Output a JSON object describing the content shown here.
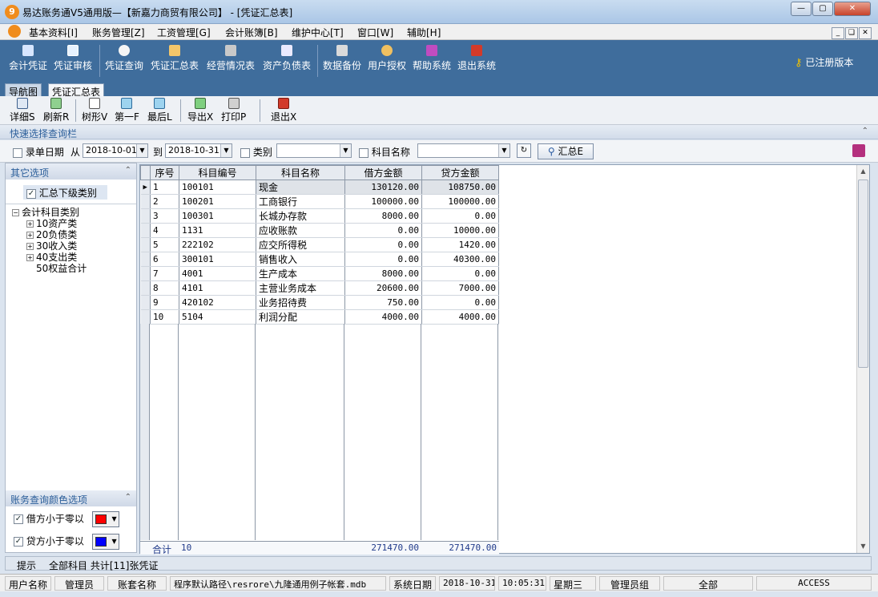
{
  "window": {
    "title": "易达账务通V5通用版—【新嘉力商贸有限公司】 - [凭证汇总表]",
    "app_icon_glyph": "9"
  },
  "menubar": {
    "items": [
      "基本资料[I]",
      "账务管理[Z]",
      "工资管理[G]",
      "会计账簿[B]",
      "维护中心[T]",
      "窗口[W]",
      "辅助[H]"
    ]
  },
  "main_toolbar": {
    "buttons": [
      "会计凭证",
      "凭证审核",
      "凭证查询",
      "凭证汇总表",
      "经营情况表",
      "资产负债表",
      "数据备份",
      "用户授权",
      "帮助系统",
      "退出系统"
    ],
    "registered_label": "已注册版本"
  },
  "tabs": [
    "导航图",
    "凭证汇总表"
  ],
  "sub_toolbar": {
    "buttons": [
      "详细S",
      "刷新R",
      "树形V",
      "第一F",
      "最后L",
      "导出X",
      "打印P",
      "退出X"
    ]
  },
  "quick_query": {
    "header": "快速选择查询栏",
    "entry_date_label": "录单日期",
    "from_label": "从",
    "date_from": "2018-10-01",
    "to_label": "到",
    "date_to": "2018-10-31",
    "category_label": "类别",
    "category_value": "",
    "subject_name_label": "科目名称",
    "subject_name_value": "",
    "summary_button": "汇总E"
  },
  "left_panel": {
    "other_options_header": "其它选项",
    "summarize_subcategory_label": "汇总下级类别",
    "summarize_subcategory_checked": true,
    "tree_root": "会计科目类别",
    "tree_children": [
      "10资产类",
      "20负债类",
      "30收入类",
      "40支出类",
      "50权益合计"
    ],
    "color_options_header": "账务查询颜色选项",
    "debit_negative_label": "借方小于零以",
    "debit_negative_color": "#ff0000",
    "credit_negative_label": "贷方小于零以",
    "credit_negative_color": "#0000ff"
  },
  "grid": {
    "headers": [
      "序号",
      "科目编号",
      "科目名称",
      "借方金额",
      "贷方金额"
    ],
    "rows": [
      [
        "1",
        "100101",
        "现金",
        "130120.00",
        "108750.00"
      ],
      [
        "2",
        "100201",
        "工商银行",
        "100000.00",
        "100000.00"
      ],
      [
        "3",
        "100301",
        "长城办存款",
        "8000.00",
        "0.00"
      ],
      [
        "4",
        "1131",
        "应收账款",
        "0.00",
        "10000.00"
      ],
      [
        "5",
        "222102",
        "应交所得税",
        "0.00",
        "1420.00"
      ],
      [
        "6",
        "300101",
        "销售收入",
        "0.00",
        "40300.00"
      ],
      [
        "7",
        "4001",
        "生产成本",
        "8000.00",
        "0.00"
      ],
      [
        "8",
        "4101",
        "主营业务成本",
        "20600.00",
        "7000.00"
      ],
      [
        "9",
        "420102",
        "业务招待费",
        "750.00",
        "0.00"
      ],
      [
        "10",
        "5104",
        "利润分配",
        "4000.00",
        "4000.00"
      ]
    ],
    "total_label": "合计",
    "total_count": "10",
    "total_debit": "271470.00",
    "total_credit": "271470.00"
  },
  "hint_bar": {
    "label": "提示",
    "text": "全部科目 共计[11]张凭证"
  },
  "status_bar": {
    "user_label": "用户名称",
    "user_value": "管理员",
    "account_set_label": "账套名称",
    "path_text": "程序默认路径\\resrore\\九隆通用例子帐套.mdb",
    "sys_date_label": "系统日期",
    "sys_date": "2018-10-31",
    "time": "10:05:31",
    "weekday": "星期三",
    "group": "管理员组",
    "scope": "全部",
    "db": "ACCESS"
  }
}
